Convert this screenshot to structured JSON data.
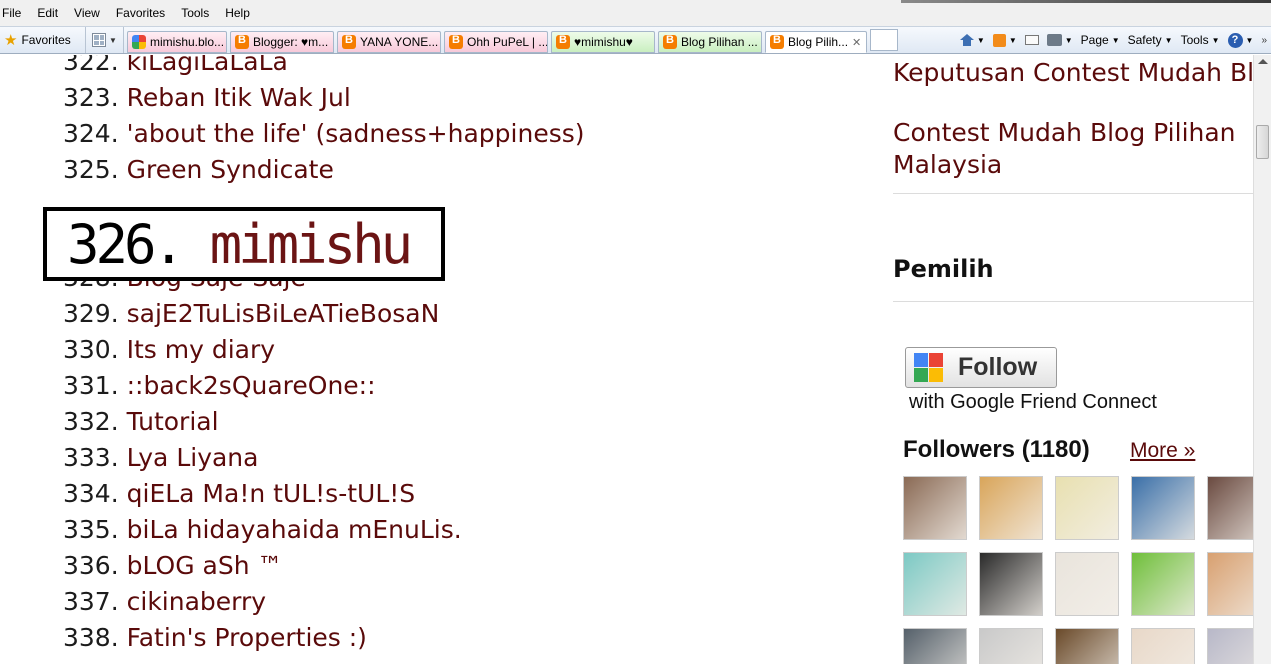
{
  "menu": [
    "File",
    "Edit",
    "View",
    "Favorites",
    "Tools",
    "Help"
  ],
  "favorites_label": "Favorites",
  "tabs": [
    {
      "label": "mimishu.blo...",
      "icon": "google-icon",
      "style": "pink"
    },
    {
      "label": "Blogger: ♥m...",
      "icon": "blogger-icon",
      "style": "pink"
    },
    {
      "label": "YANA YONE...",
      "icon": "blogger-icon",
      "style": "pink"
    },
    {
      "label": "Ohh PuPeL | ...",
      "icon": "blogger-icon",
      "style": "pink"
    },
    {
      "label": "♥mimishu♥",
      "icon": "blogger-icon",
      "style": "green"
    },
    {
      "label": "Blog Pilihan ...",
      "icon": "blogger-icon",
      "style": "green"
    },
    {
      "label": "Blog Pilih...",
      "icon": "blogger-icon",
      "style": "active"
    }
  ],
  "commands": {
    "page": "Page",
    "safety": "Safety",
    "tools": "Tools"
  },
  "list": [
    {
      "num": "322.",
      "name": "kiLagiLaLaLa"
    },
    {
      "num": "323.",
      "name": "Reban Itik Wak Jul"
    },
    {
      "num": "324.",
      "name": "'about the life' (sadness+happiness)"
    },
    {
      "num": "325.",
      "name": "Green Syndicate"
    },
    {
      "num": "328.",
      "name": "Blog Saje-Saje"
    },
    {
      "num": "329.",
      "name": "sajE2TuLisBiLeATieBosaN"
    },
    {
      "num": "330.",
      "name": "Its my diary"
    },
    {
      "num": "331.",
      "name": "::back2sQuareOne::"
    },
    {
      "num": "332.",
      "name": "Tutorial"
    },
    {
      "num": "333.",
      "name": "Lya Liyana"
    },
    {
      "num": "334.",
      "name": "qiELa Ma!n tUL!s-tUL!S"
    },
    {
      "num": "335.",
      "name": "biLa hidayahaida mEnuLis."
    },
    {
      "num": "336.",
      "name": "bLOG aSh ™"
    },
    {
      "num": "337.",
      "name": "cikinaberry"
    },
    {
      "num": "338.",
      "name": "Fatin's Properties :)"
    }
  ],
  "highlight": {
    "num": "326.",
    "name": "mimishu"
  },
  "sidebar": {
    "link1": "Keputusan Contest Mudah Blog",
    "link2": "Contest Mudah Blog Pilihan",
    "link2b": "Malaysia",
    "heading": "Pemilih",
    "follow_label": "Follow",
    "gfc_text": "with Google Friend Connect",
    "followers_title": "Followers (1180)",
    "more_label": "More »"
  },
  "avatar_colors": [
    [
      "#8a6a55",
      "#d9a55a",
      "#e8e0b0",
      "#3a6fa8",
      "#6a4a40"
    ],
    [
      "#7cc9c4",
      "#2a2a2a",
      "#e9e4dc",
      "#6fbf3a",
      "#d8a070"
    ],
    [
      "#55606a",
      "#c9c9c9",
      "#6a4a2a",
      "#e8d8c8",
      "#b8b8c8"
    ]
  ]
}
